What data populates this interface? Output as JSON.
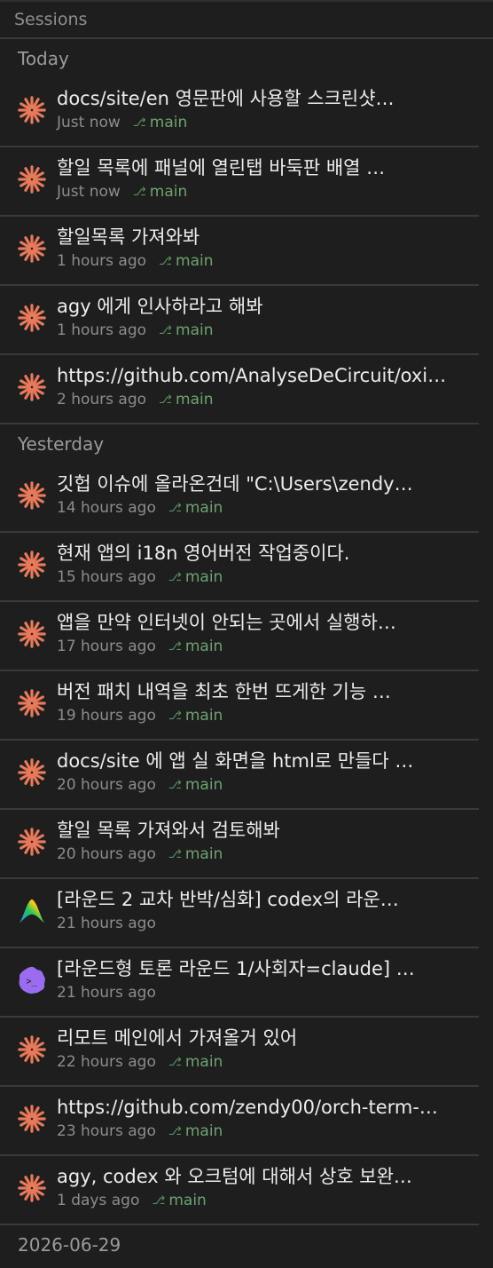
{
  "panel": {
    "title": "Sessions"
  },
  "colors": {
    "background": "#1e1e1e",
    "accent_claude": "#e8795a",
    "branch": "#6da36f",
    "gemini_bg": "#9b6cf0"
  },
  "groups": [
    {
      "label": "Today",
      "sessions": [
        {
          "icon": "claude-icon",
          "title": "docs/site/en 영문판에 사용할 스크린샷…",
          "time": "Just now",
          "branch": "main"
        },
        {
          "icon": "claude-icon",
          "title": "할일 목록에 패널에 열린탭 바둑판 배열 …",
          "time": "Just now",
          "branch": "main"
        },
        {
          "icon": "claude-icon",
          "title": "할일목록 가져와봐",
          "time": "1 hours ago",
          "branch": "main"
        },
        {
          "icon": "claude-icon",
          "title": "agy 에게 인사하라고 해봐",
          "time": "1 hours ago",
          "branch": "main"
        },
        {
          "icon": "claude-icon",
          "title": "https://github.com/AnalyseDeCircuit/oxi…",
          "time": "2 hours ago",
          "branch": "main"
        }
      ]
    },
    {
      "label": "Yesterday",
      "sessions": [
        {
          "icon": "claude-icon",
          "title": "깃헙 이슈에 올라온건데 \"C:\\Users\\zendy…",
          "time": "14 hours ago",
          "branch": "main"
        },
        {
          "icon": "claude-icon",
          "title": "현재 앱의 i18n 영어버전 작업중이다.",
          "time": "15 hours ago",
          "branch": "main"
        },
        {
          "icon": "claude-icon",
          "title": "앱을 만약 인터넷이 안되는 곳에서 실행하…",
          "time": "17 hours ago",
          "branch": "main"
        },
        {
          "icon": "claude-icon",
          "title": "버전 패치 내역을 최초 한번 뜨게한 기능 …",
          "time": "19 hours ago",
          "branch": "main"
        },
        {
          "icon": "claude-icon",
          "title": "docs/site 에 앱 실 화면을 html로 만들다 …",
          "time": "20 hours ago",
          "branch": "main"
        },
        {
          "icon": "claude-icon",
          "title": "할일 목록 가져와서 검토해봐",
          "time": "20 hours ago",
          "branch": "main"
        },
        {
          "icon": "antigravity-icon",
          "title": "[라운드 2 교차 반박/심화] codex의 라운…",
          "time": "21 hours ago",
          "branch": ""
        },
        {
          "icon": "gemini-cli-icon",
          "title": "[라운드형 토론 라운드 1/사회자=claude] …",
          "time": "21 hours ago",
          "branch": ""
        },
        {
          "icon": "claude-icon",
          "title": "리모트 메인에서 가져올거 있어",
          "time": "22 hours ago",
          "branch": "main"
        },
        {
          "icon": "claude-icon",
          "title": "https://github.com/zendy00/orch-term-…",
          "time": "23 hours ago",
          "branch": "main"
        },
        {
          "icon": "claude-icon",
          "title": "agy, codex 와 오크텀에 대해서 상호 보완…",
          "time": "1 days ago",
          "branch": "main"
        }
      ]
    },
    {
      "label": "2026-06-29",
      "sessions": []
    }
  ]
}
